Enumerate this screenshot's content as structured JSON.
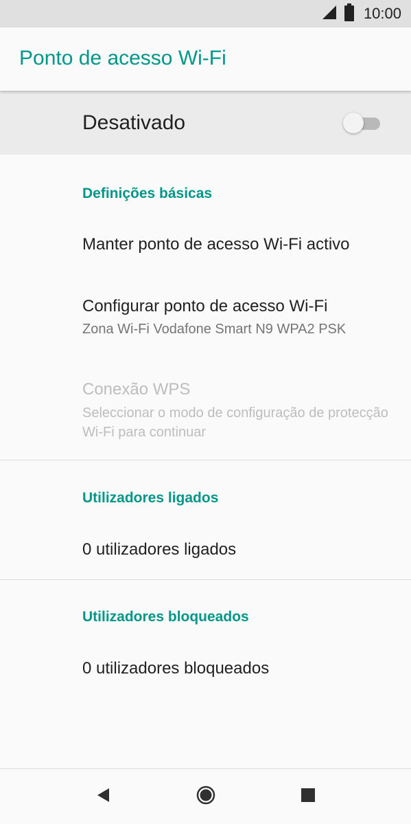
{
  "status_bar": {
    "time": "10:00",
    "icons": [
      "signal-icon",
      "battery-icon"
    ]
  },
  "app_bar": {
    "title": "Ponto de acesso Wi-Fi"
  },
  "master_switch": {
    "label": "Desativado",
    "enabled": false
  },
  "sections": {
    "basic": {
      "header": "Definições básicas",
      "keep_active": {
        "title": "Manter ponto de acesso Wi-Fi activo"
      },
      "configure": {
        "title": "Configurar ponto de acesso Wi-Fi",
        "summary": "Zona Wi-Fi Vodafone Smart N9 WPA2 PSK"
      },
      "wps": {
        "title": "Conexão WPS",
        "summary": "Seleccionar o modo de configuração de protecção Wi-Fi para continuar"
      }
    },
    "connected": {
      "header": "Utilizadores ligados",
      "item": "0 utilizadores ligados"
    },
    "blocked": {
      "header": "Utilizadores bloqueados",
      "item": "0 utilizadores bloqueados"
    }
  },
  "nav_bar": {
    "icons": [
      "back-icon",
      "home-icon",
      "recents-icon"
    ]
  },
  "colors": {
    "accent": "#009688",
    "status_bar_bg": "#e0e0e0",
    "switch_row_bg": "#ebebeb",
    "background": "#fafafa"
  }
}
